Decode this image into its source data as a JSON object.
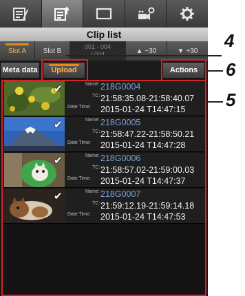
{
  "tabs": [
    {
      "icon": "clip-list-icon",
      "active": false
    },
    {
      "icon": "upload-list-icon",
      "active": true
    },
    {
      "icon": "monitor-icon",
      "active": false
    },
    {
      "icon": "camera-settings-icon",
      "active": false
    },
    {
      "icon": "gear-icon",
      "active": false
    }
  ],
  "title": "Clip list",
  "slot_bar": {
    "slot_a": "Slot A",
    "slot_b": "Slot B",
    "range_top": "001 - 004",
    "range_bottom": "/ 004",
    "prev_page": "▲ −30",
    "next_page": "▼ +30"
  },
  "action_bar": {
    "meta_data": "Meta data",
    "upload": "Upload",
    "actions": "Actions"
  },
  "labels": {
    "name": "Name:",
    "tc": "TC:",
    "datetime": "Date Time:"
  },
  "clips": [
    {
      "name": "218G0004",
      "tc": "21:58:35.08-21:58:40.07",
      "datetime": "2015-01-24 T14:47:15",
      "checked": true,
      "thumb": "flowers"
    },
    {
      "name": "218G0005",
      "tc": "21:58:47.22-21:58:50.21",
      "datetime": "2015-01-24 T14:47:28",
      "checked": true,
      "thumb": "mountain"
    },
    {
      "name": "218G0006",
      "tc": "21:58:57.02-21:59:00.03",
      "datetime": "2015-01-24 T14:47:37",
      "checked": true,
      "thumb": "cat-green"
    },
    {
      "name": "218G0007",
      "tc": "21:59:12.19-21:59:14.18",
      "datetime": "2015-01-24 T14:47:53",
      "checked": true,
      "thumb": "cat-brown"
    }
  ],
  "callouts": {
    "four": "4",
    "five": "5",
    "six": "6"
  },
  "colors": {
    "accent": "#e88a1a",
    "callout_border": "#d8222a",
    "name_text": "#7aa0d8"
  }
}
